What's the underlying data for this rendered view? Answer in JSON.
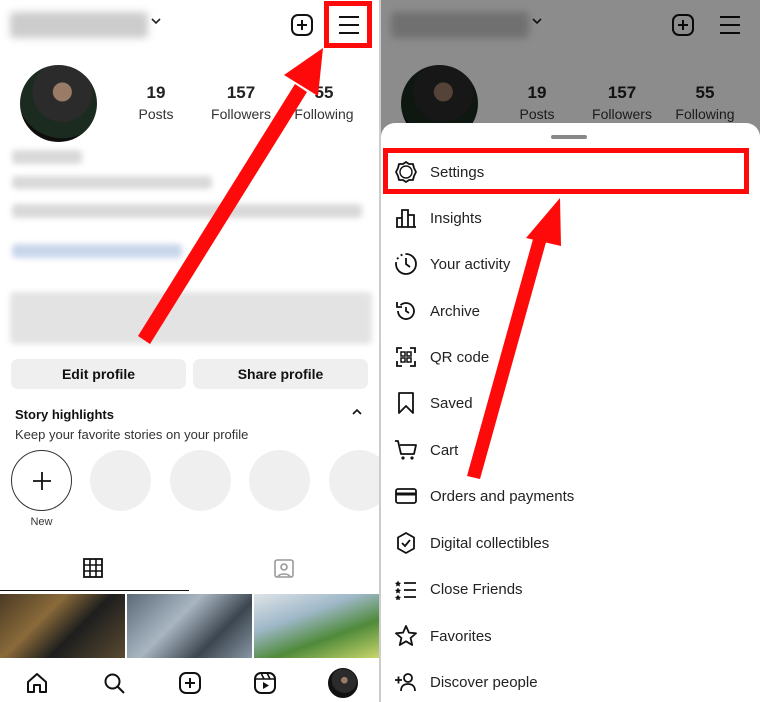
{
  "profile": {
    "stats": [
      {
        "num": "19",
        "label": "Posts"
      },
      {
        "num": "157",
        "label": "Followers"
      },
      {
        "num": "55",
        "label": "Following"
      }
    ],
    "buttons": {
      "edit": "Edit profile",
      "share": "Share profile"
    },
    "highlights": {
      "title": "Story highlights",
      "subtitle": "Keep your favorite stories on your profile",
      "new_label": "New"
    }
  },
  "menu": {
    "items": [
      {
        "label": "Settings",
        "icon": "settings-icon"
      },
      {
        "label": "Insights",
        "icon": "insights-icon"
      },
      {
        "label": "Your activity",
        "icon": "activity-icon"
      },
      {
        "label": "Archive",
        "icon": "archive-icon"
      },
      {
        "label": "QR code",
        "icon": "qr-code-icon"
      },
      {
        "label": "Saved",
        "icon": "bookmark-icon"
      },
      {
        "label": "Cart",
        "icon": "cart-icon"
      },
      {
        "label": "Orders and payments",
        "icon": "card-icon"
      },
      {
        "label": "Digital collectibles",
        "icon": "collectibles-icon"
      },
      {
        "label": "Close Friends",
        "icon": "close-friends-icon"
      },
      {
        "label": "Favorites",
        "icon": "star-icon"
      },
      {
        "label": "Discover people",
        "icon": "add-person-icon"
      }
    ]
  },
  "colors": {
    "annotation": "#ff0a0a",
    "accent_text": "#111111",
    "button_bg": "#efefef"
  }
}
